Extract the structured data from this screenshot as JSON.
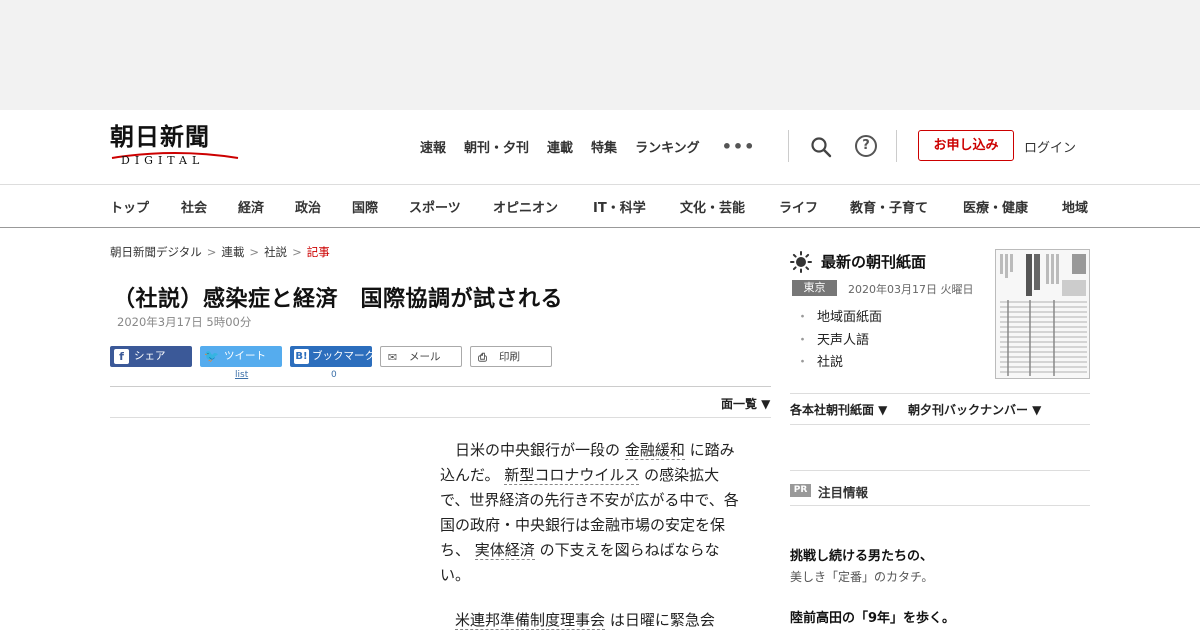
{
  "logo": {
    "kanji": "朝日新聞",
    "sub": "DIGITAL"
  },
  "topnav": [
    "速報",
    "朝刊・夕刊",
    "連載",
    "特集",
    "ランキング"
  ],
  "more_icon": "•••",
  "help_icon": "?",
  "apply_label": "お申し込み",
  "login_label": "ログイン",
  "categories": [
    "トップ",
    "社会",
    "経済",
    "政治",
    "国際",
    "スポーツ",
    "オピニオン",
    "IT・科学",
    "文化・芸能",
    "ライフ",
    "教育・子育て",
    "医療・健康",
    "地域"
  ],
  "breadcrumb": [
    "朝日新聞デジタル",
    "連載",
    "社説",
    "記事"
  ],
  "breadcrumb_sep": ">",
  "article": {
    "title": "（社説）感染症と経済　国際協調が試される",
    "date": "2020年3月17日 5時00分",
    "p1": [
      "日米の中央銀行が一段の",
      "金融緩和",
      "に踏み込んだ。",
      "新型コロナウイルス",
      "の感染拡大で、世界経済の先行き不安が広がる中で、各国の政府・中央銀行は金融市場の安定を保ち、",
      "実体経済",
      "の下支えを図らねばならない。"
    ],
    "p2": [
      "米連邦準備制度理事会",
      "は日曜に緊急会"
    ]
  },
  "share": {
    "facebook": "シェア",
    "twitter": "ツイート",
    "hatena": "ブックマーク",
    "mail": "メール",
    "print": "印刷",
    "twitter_count": "list",
    "hatena_count": "0"
  },
  "share_glyphs": {
    "facebook": "f",
    "twitter": "🐦",
    "hatena": "B!",
    "mail": "✉",
    "print": "⎙"
  },
  "page_list_label": "面一覧 ▼",
  "sidebar": {
    "title": "最新の朝刊紙面",
    "edition": "東京",
    "edition_date": "2020年03月17日 火曜日",
    "links": [
      "地域面紙面",
      "天声人語",
      "社説"
    ],
    "bullet": "・",
    "dropdowns": [
      "各本社朝刊紙面 ▼",
      "朝夕刊バックナンバー ▼"
    ],
    "pr_badge": "PR",
    "pr_title": "注目情報",
    "promos": [
      {
        "title": "挑戦し続ける男たちの、",
        "sub": "美しき「定番」のカタチ。"
      },
      {
        "title": "陸前高田の「9年」を歩く。",
        "sub": ""
      }
    ]
  },
  "colors": {
    "accent": "#cc0000",
    "facebook": "#3b5998",
    "twitter": "#55acee",
    "hatena": "#2c6ebd"
  },
  "icons": [
    "search-icon",
    "help-icon",
    "more-icon",
    "sun-icon",
    "facebook-icon",
    "twitter-icon",
    "hatena-icon",
    "mail-icon",
    "print-icon"
  ]
}
